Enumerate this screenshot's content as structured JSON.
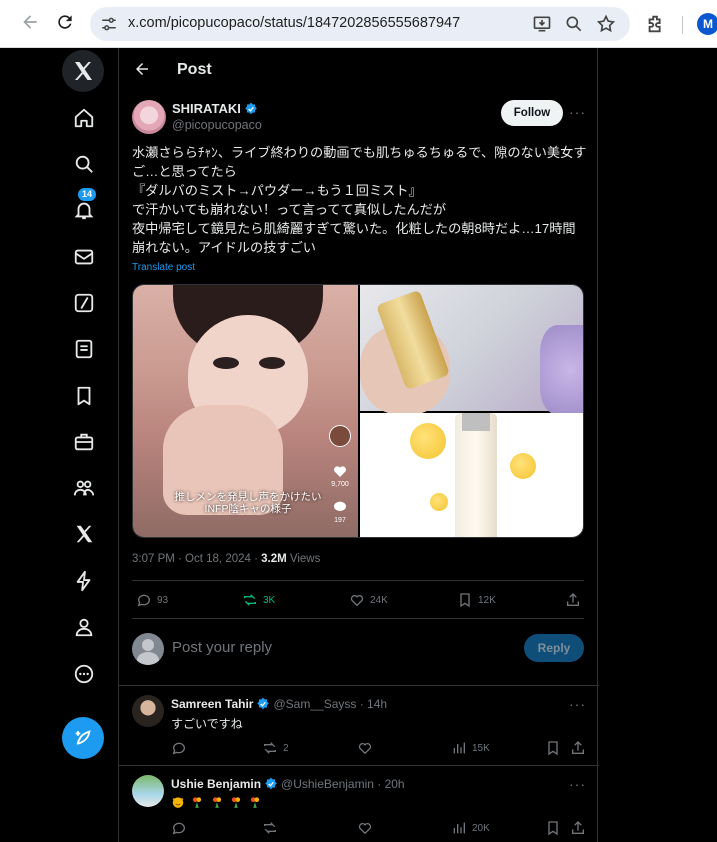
{
  "browser": {
    "url": "x.com/picopucopaco/status/1847202856555687947",
    "profile_initial": "M"
  },
  "nav": {
    "notifications_badge": "14"
  },
  "header": {
    "title": "Post"
  },
  "post": {
    "author_name": "SHIRATAKI",
    "author_handle": "@picopucopaco",
    "follow_label": "Follow",
    "text": "水瀬さららﾁｬﾝ、ライブ終わりの動画でも肌ちゅるちゅるで、隙のない美女すご…と思ってたら\n『ダルバのミスト→パウダー→もう１回ミスト』\nで汗かいても崩れない！って言ってて真似したんだが\n夜中帰宅して鏡見たら肌綺麗すぎて驚いた。化粧したの朝8時だよ…17時間崩れない。アイドルの技すごい",
    "translate_label": "Translate post",
    "media_caption": "推しメンを発見し声をかけたい\nINFP陰キャの様子",
    "media_likes": "9,700",
    "media_comments": "197",
    "time": "3:07 PM · Oct 18, 2024 · ",
    "views_count": "3.2M",
    "views_label": " Views",
    "replies": "93",
    "reposts": "3K",
    "likes": "24K",
    "bookmarks": "12K"
  },
  "reply_box": {
    "placeholder": "Post your reply",
    "button_label": "Reply"
  },
  "comments": [
    {
      "name": "Samreen Tahir",
      "meta": "@Sam__Sayss · 14h",
      "text": "すごいですね",
      "reposts": "2",
      "views": "15K"
    },
    {
      "name": "Ushie Benjamin",
      "meta": "@UshieBenjamin · 20h",
      "text": "",
      "views": "20K"
    }
  ],
  "colors": {
    "accent": "#1d9bf0",
    "repost_active": "#00ba7c",
    "muted": "#71767b"
  }
}
